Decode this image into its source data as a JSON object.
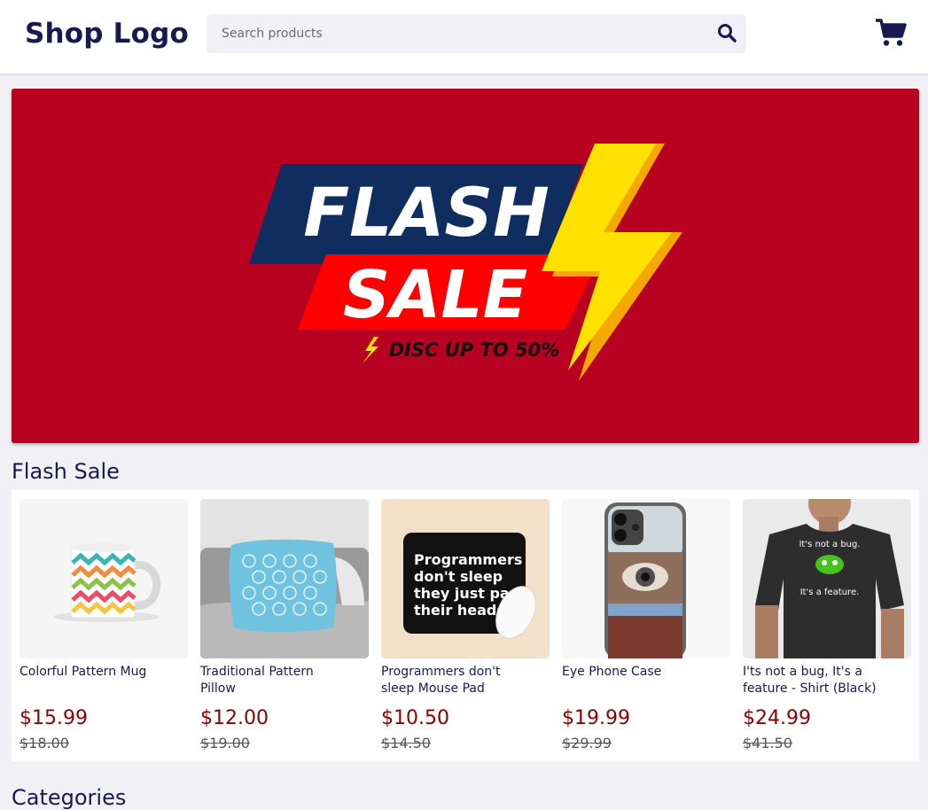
{
  "header": {
    "logo": "Shop Logo",
    "search_placeholder": "Search products",
    "search_icon": "search-icon",
    "cart_icon": "shopping-cart-icon"
  },
  "banner": {
    "line1": "FLASH",
    "line2": "SALE",
    "tagline": "DISC UP TO 50%",
    "colors": {
      "background": "#b80020",
      "navy": "#0f2d5e",
      "red": "#ff0000",
      "bolt": "#ffe100"
    }
  },
  "flash_sale": {
    "title": "Flash Sale",
    "products": [
      {
        "name": "Colorful Pattern Mug",
        "price": "$15.99",
        "old_price": "$18.00",
        "image": "mug"
      },
      {
        "name": "Traditional Pattern Pillow",
        "price": "$12.00",
        "old_price": "$19.00",
        "image": "pillow"
      },
      {
        "name": "Programmers don't sleep Mouse Pad",
        "price": "$10.50",
        "old_price": "$14.50",
        "image": "mousepad",
        "image_text": [
          "Programmers",
          "don't sleep",
          "they just park",
          "their heads."
        ]
      },
      {
        "name": "Eye Phone Case",
        "price": "$19.99",
        "old_price": "$29.99",
        "image": "phone-case"
      },
      {
        "name": "I'ts not a bug, It's a feature - Shirt (Black)",
        "price": "$24.99",
        "old_price": "$41.50",
        "image": "t-shirt",
        "image_text": [
          "It's not a bug.",
          "It's a feature."
        ]
      }
    ]
  },
  "next_section": {
    "title": "Categories"
  },
  "colors": {
    "accent": "#1a1850",
    "price": "#8b0000"
  }
}
